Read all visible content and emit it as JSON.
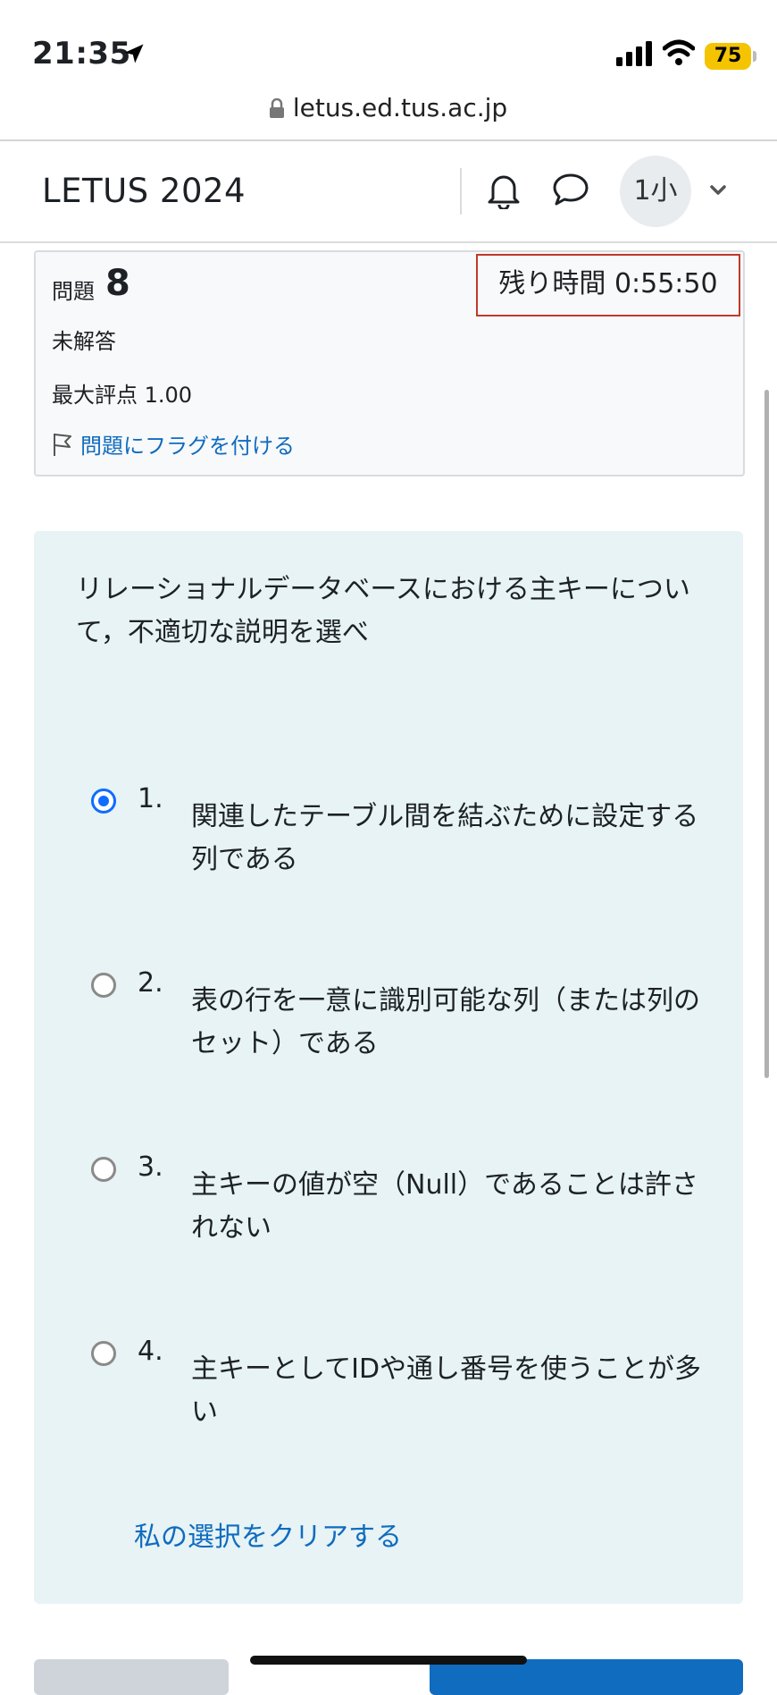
{
  "status_bar": {
    "time": "21:35",
    "battery": "75"
  },
  "url_bar": {
    "url": "letus.ed.tus.ac.jp"
  },
  "navbar": {
    "brand": "LETUS 2024",
    "avatar_initials": "1小"
  },
  "info": {
    "question_label": "問題",
    "question_number": "8",
    "timer": "残り時間 0:55:50",
    "state": "未解答",
    "marks": "最大評点 1.00",
    "flag_label": "問題にフラグを付ける"
  },
  "question": {
    "text": "リレーショナルデータベースにおける主キーについて，不適切な説明を選べ",
    "selected_index": 0,
    "answers": [
      {
        "num": "1.",
        "text": "関連したテーブル間を結ぶために設定する列である"
      },
      {
        "num": "2.",
        "text": "表の行を一意に識別可能な列（または列のセット）である"
      },
      {
        "num": "3.",
        "text": "主キーの値が空（Null）であることは許されない"
      },
      {
        "num": "4.",
        "text": "主キーとしてIDや通し番号を使うことが多い"
      }
    ],
    "clear_label": "私の選択をクリアする"
  },
  "colors": {
    "accent": "#0f6cbf",
    "timer_border": "#c0392b",
    "question_bg": "#e7f3f5",
    "battery": "#f5c400"
  }
}
